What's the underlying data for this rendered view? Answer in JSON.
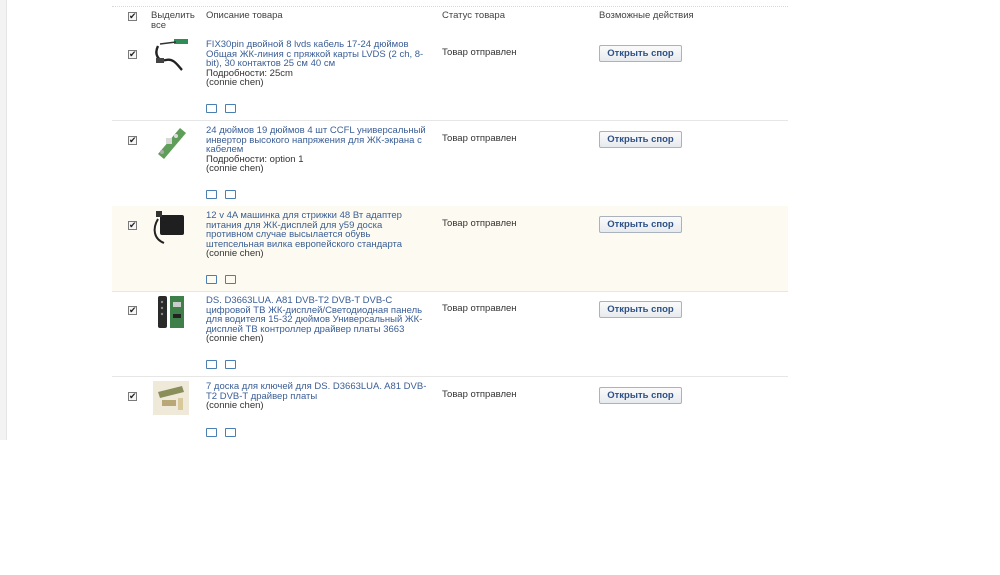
{
  "header": {
    "select_all_label": "Выделить все",
    "col_description": "Описание товара",
    "col_status": "Статус товара",
    "col_actions": "Возможные действия"
  },
  "items": [
    {
      "title": "FIX30pin двойной 8 lvds кабель 17-24 дюймов Общая ЖК-линия с пряжкой карты LVDS (2 ch, 8-bit), 30 контактов 25 см 40 см",
      "details": "Подробности: 25cm",
      "seller": "(connie chen)",
      "status": "Товар отправлен",
      "action": "Открыть спор",
      "checked": true
    },
    {
      "title": "24 дюймов 19 дюймов 4 шт CCFL универсальный инвертор высокого напряжения для ЖК-экрана с кабелем",
      "details": "Подробности: option 1",
      "seller": "(connie chen)",
      "status": "Товар отправлен",
      "action": "Открыть спор",
      "checked": true
    },
    {
      "title": "12 v 4A машинка для стрижки 48 Вт адаптер питания для ЖК-дисплей для у59 доска противном случае высылается обувь штепсельная вилка европейского стандарта",
      "details": "",
      "seller": "(connie chen)",
      "status": "Товар отправлен",
      "action": "Открыть спор",
      "checked": true
    },
    {
      "title": "DS. D3663LUA. A81 DVB-T2 DVB-T DVB-C цифровой ТВ ЖК-дисплей/Светодиодная панель для водителя 15-32 дюймов Универсальный ЖК-дисплей ТВ контроллер драйвер платы 3663",
      "details": "",
      "seller": "(connie chen)",
      "status": "Товар отправлен",
      "action": "Открыть спор",
      "checked": true
    },
    {
      "title": "7 доска для ключей для DS. D3663LUA. A81 DVB-T2 DVB-T драйвер платы",
      "details": "",
      "seller": "(connie chen)",
      "status": "Товар отправлен",
      "action": "Открыть спор",
      "checked": true
    }
  ]
}
